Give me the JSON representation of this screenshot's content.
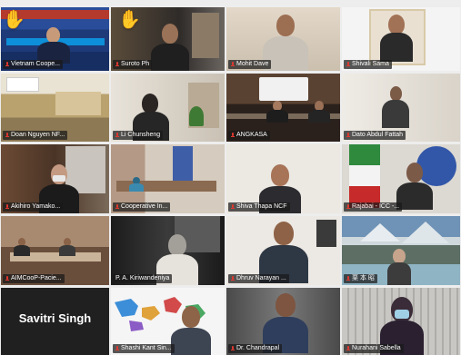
{
  "gallery": {
    "tiles": [
      {
        "name": "Vietnam Coope...",
        "muted": true,
        "hand_raised": true
      },
      {
        "name": "Suroto Ph",
        "muted": true,
        "hand_raised": true
      },
      {
        "name": "Mohit Dave",
        "muted": true
      },
      {
        "name": "Shivali Sama",
        "muted": true
      },
      {
        "name": "Doan Nguyen NF...",
        "muted": true
      },
      {
        "name": "Li Chunsheng",
        "muted": true
      },
      {
        "name": "ANGKASA",
        "muted": true
      },
      {
        "name": "Dato Abdul Fattah",
        "muted": true
      },
      {
        "name": "Akihiro Yamako...",
        "muted": true
      },
      {
        "name": "Cooperative In...",
        "muted": true
      },
      {
        "name": "Shiva Thapa NCF",
        "muted": true
      },
      {
        "name": "Rajabai - ICC -...",
        "muted": true
      },
      {
        "name": "AIMCooP-Pacie...",
        "muted": true
      },
      {
        "name": "P. A. Kiriwandeniya",
        "muted": false,
        "active_speaker": true
      },
      {
        "name": "Dhruv Narayan ...",
        "muted": true
      },
      {
        "name": "栗 本 昭",
        "muted": true
      },
      {
        "name": "Savitri Singh",
        "muted": false,
        "video_off": true
      },
      {
        "name": "Shashi Kant Sin...",
        "muted": true
      },
      {
        "name": "Dr. Chandrapal",
        "muted": true
      },
      {
        "name": "Nurahani Sabella",
        "muted": true
      }
    ]
  },
  "icons": {
    "raise_hand": "✋",
    "mic_muted": "mic-muted-icon"
  },
  "colors": {
    "active_speaker_border": "#c7d84a",
    "muted_mic": "#e0382f",
    "hand": "#f5c542"
  }
}
